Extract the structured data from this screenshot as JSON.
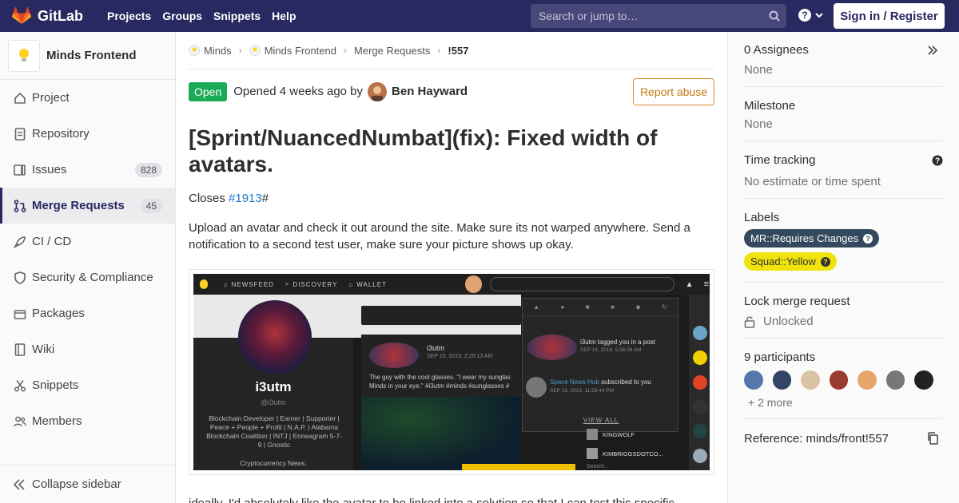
{
  "nav": {
    "brand": "GitLab",
    "links": [
      "Projects",
      "Groups",
      "Snippets",
      "Help"
    ],
    "search_placeholder": "Search or jump to…",
    "sign_in": "Sign in / Register"
  },
  "sidebar": {
    "project_name": "Minds Frontend",
    "items": [
      {
        "label": "Project",
        "icon": "home-icon"
      },
      {
        "label": "Repository",
        "icon": "doc-icon"
      },
      {
        "label": "Issues",
        "icon": "issues-icon",
        "count": "828"
      },
      {
        "label": "Merge Requests",
        "icon": "merge-request-icon",
        "count": "45"
      },
      {
        "label": "CI / CD",
        "icon": "rocket-icon"
      },
      {
        "label": "Security & Compliance",
        "icon": "shield-icon"
      },
      {
        "label": "Packages",
        "icon": "package-icon"
      },
      {
        "label": "Wiki",
        "icon": "book-icon"
      },
      {
        "label": "Snippets",
        "icon": "scissors-icon"
      },
      {
        "label": "Members",
        "icon": "users-icon"
      }
    ],
    "collapse": "Collapse sidebar"
  },
  "breadcrumb": [
    "Minds",
    "Minds Frontend",
    "Merge Requests",
    "!557"
  ],
  "mr": {
    "status": "Open",
    "opened": "Opened 4 weeks ago by",
    "author": "Ben Hayward",
    "report": "Report abuse",
    "title": "[Sprint/NuancedNumbat](fix): Fixed width of avatars.",
    "closes_prefix": "Closes ",
    "closes_link": "#1913",
    "closes_suffix": "#",
    "description": "Upload an avatar and check it out around the site. Make sure its not warped anywhere. Send a notification to a second test user, make sure your picture shows up okay."
  },
  "embedded": {
    "nav": [
      "NEWSFEED",
      "DISCOVERY",
      "WALLET"
    ],
    "username": "i3utm",
    "handle": "@i3utm",
    "bio": "Blockchain Developer | Earner | Supporter | Peace + People + Profit | N.A.P. | Alabama Blockchain Coalition | INTJ | Enneagram 5-7-9 | Gnostic",
    "crypto": "Cryptocurrency News:",
    "post_user": "i3utm",
    "post_date": "SEP 15, 2019, 2:29:13 AM",
    "post_text": "The guy with the cool glasses. \"I wear my sunglas Minds in your eye.\" #i3utm #minds #sunglasses #",
    "notif1": "i3utm tagged you in a post",
    "notif1_date": "SEP 14, 2019, 5:36:08 AM",
    "notif2_a": "Space News Hub",
    "notif2_b": " subscribed to you",
    "notif2_date": "SEP 13, 2019, 11:39:44 PM",
    "view_all": "VIEW ALL",
    "list1": "KINGWOLF",
    "list2": "KIMBRIGGSDOTCO...",
    "search": "Search..."
  },
  "bottom_text": "ideally, I'd absolutely like the avatar to be linked into a solution so that I can test this specific",
  "right": {
    "assignees": "0 Assignees",
    "assignees_value": "None",
    "milestone": "Milestone",
    "milestone_value": "None",
    "time_tracking": "Time tracking",
    "time_value": "No estimate or time spent",
    "labels": "Labels",
    "label1": "MR::Requires Changes",
    "label2": "Squad::Yellow",
    "lock": "Lock merge request",
    "lock_value": "Unlocked",
    "participants": "9 participants",
    "more": "+ 2 more",
    "reference": "Reference: minds/front!557"
  },
  "colors": {
    "nav_bg": "#292961",
    "open_badge": "#1aaa55",
    "link": "#1f78d1",
    "label_dark": "#34495e",
    "label_yellow": "#f0e20c"
  }
}
